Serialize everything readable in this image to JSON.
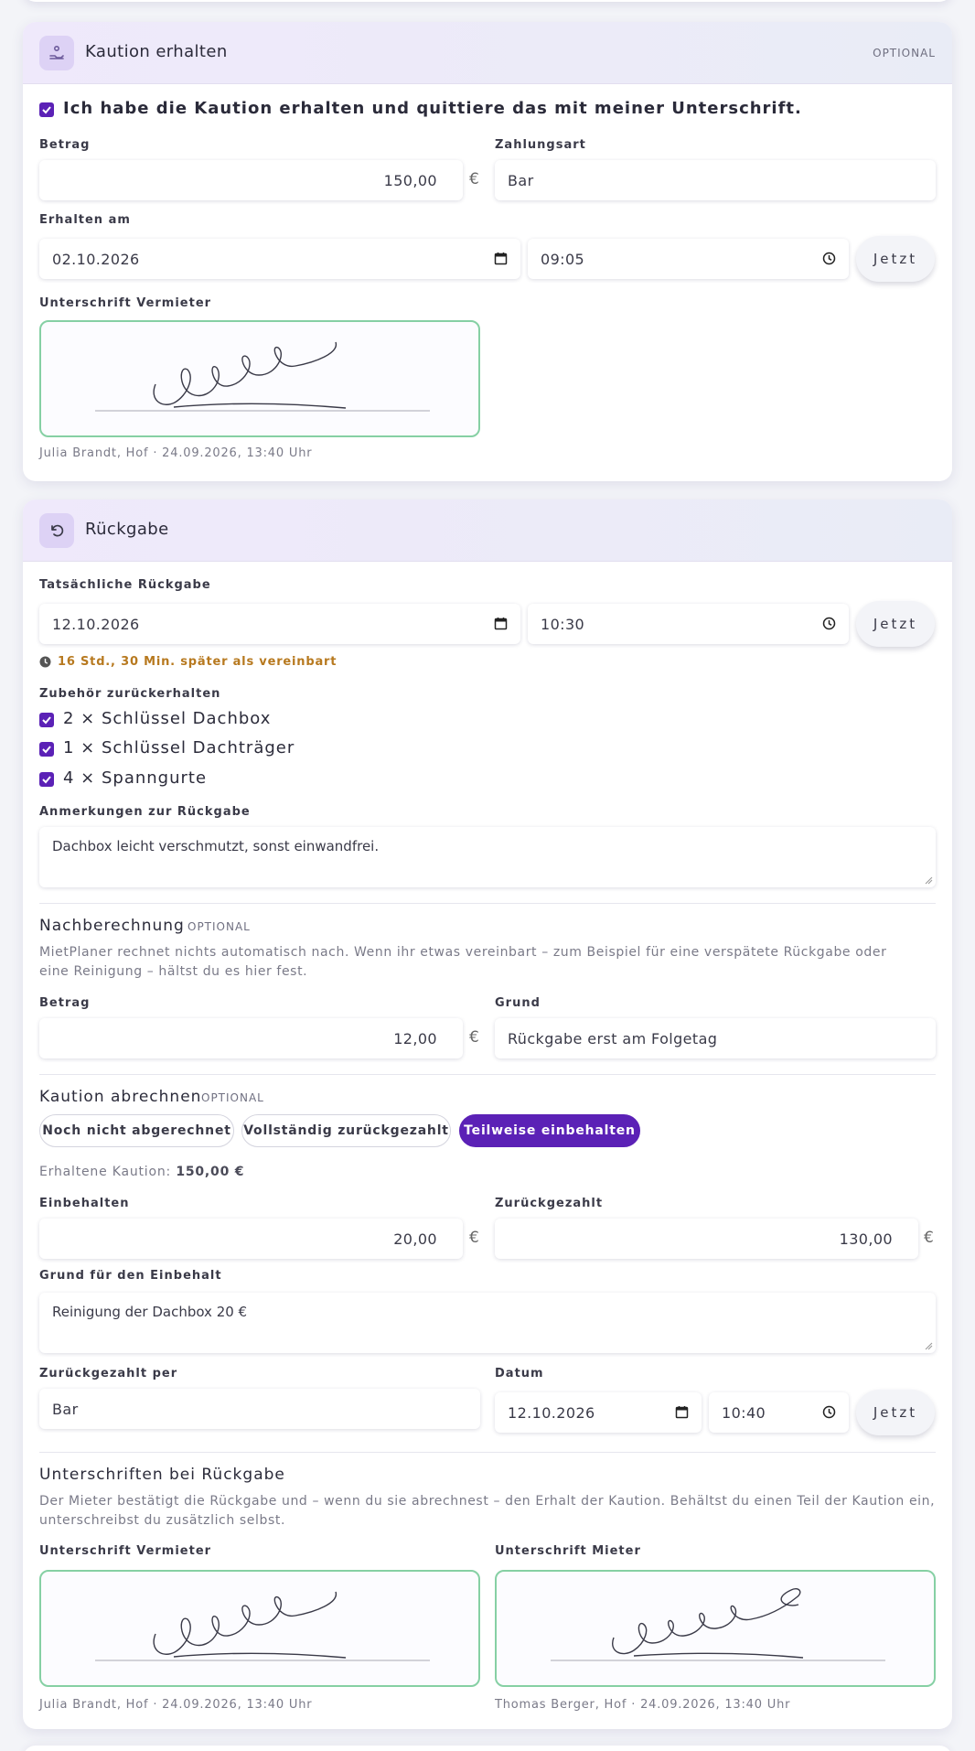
{
  "kaution": {
    "title": "Kaution erhalten",
    "optional": "OPTIONAL",
    "confirm_label": "Ich habe die Kaution erhalten und quittiere das mit meiner Unterschrift.",
    "amount_label": "Betrag",
    "amount_value": "150,00",
    "currency": "€",
    "payment_label": "Zahlungsart",
    "payment_value": "Bar",
    "received_label": "Erhalten am",
    "received_date": "02.10.2026",
    "received_time": "09:05",
    "now_label": "Jetzt",
    "signature_label": "Unterschrift Vermieter",
    "signature_caption": "Julia Brandt, Hof · 24.09.2026, 13:40 Uhr"
  },
  "rueckgabe": {
    "title": "Rückgabe",
    "actual_label": "Tatsächliche Rückgabe",
    "actual_date": "12.10.2026",
    "actual_time": "10:30",
    "now_label": "Jetzt",
    "late_note": "16 Std., 30 Min. später als vereinbart",
    "accessories_label": "Zubehör zurückerhalten",
    "accessories": [
      {
        "label": "2 × Schlüssel Dachbox",
        "checked": true
      },
      {
        "label": "1 × Schlüssel Dachträger",
        "checked": true
      },
      {
        "label": "4 × Spanngurte",
        "checked": true
      }
    ],
    "notes_label": "Anmerkungen zur Rückgabe",
    "notes_value": "Dachbox leicht verschmutzt, sonst einwandfrei.",
    "nachberechnung": {
      "title": "Nachberechnung",
      "optional": "OPTIONAL",
      "description": "MietPlaner rechnet nichts automatisch nach. Wenn ihr etwas vereinbart – zum Beispiel für eine verspätete Rückgabe oder eine Reinigung – hältst du es hier fest.",
      "amount_label": "Betrag",
      "amount_value": "12,00",
      "currency": "€",
      "reason_label": "Grund",
      "reason_value": "Rückgabe erst am Folgetag"
    },
    "abrechnung": {
      "title": "Kaution abrechnen",
      "optional": "OPTIONAL",
      "options": [
        "Noch nicht abgerechnet",
        "Vollständig zurückgezahlt",
        "Teilweise einbehalten"
      ],
      "selected": "Teilweise einbehalten",
      "received_prefix": "Erhaltene Kaution: ",
      "received_amount": "150,00 €",
      "withheld_label": "Einbehalten",
      "withheld_value": "20,00",
      "repaid_label": "Zurückgezahlt",
      "repaid_value": "130,00",
      "currency": "€",
      "withheld_reason_label": "Grund für den Einbehalt",
      "withheld_reason_value": "Reinigung der Dachbox 20 €",
      "repaid_via_label": "Zurückgezahlt per",
      "repaid_via_value": "Bar",
      "date_label": "Datum",
      "date_value": "12.10.2026",
      "time_value": "10:40",
      "now_label": "Jetzt"
    },
    "signatures": {
      "title": "Unterschriften bei Rückgabe",
      "description": "Der Mieter bestätigt die Rückgabe und – wenn du sie abrechnest – den Erhalt der Kaution. Behältst du einen Teil der Kaution ein, unterschreibst du zusätzlich selbst.",
      "landlord_label": "Unterschrift Vermieter",
      "landlord_caption": "Julia Brandt, Hof · 24.09.2026, 13:40 Uhr",
      "tenant_label": "Unterschrift Mieter",
      "tenant_caption": "Thomas Berger, Hof · 24.09.2026, 13:40 Uhr"
    }
  },
  "colors": {
    "accent": "#5b21b6",
    "signature_border": "#86d0a4",
    "warning": "#b7791f"
  },
  "icons": {
    "kaution": "hand-coin-icon",
    "rueckgabe": "undo-icon",
    "calendar": "calendar-icon",
    "clock": "clock-icon"
  }
}
